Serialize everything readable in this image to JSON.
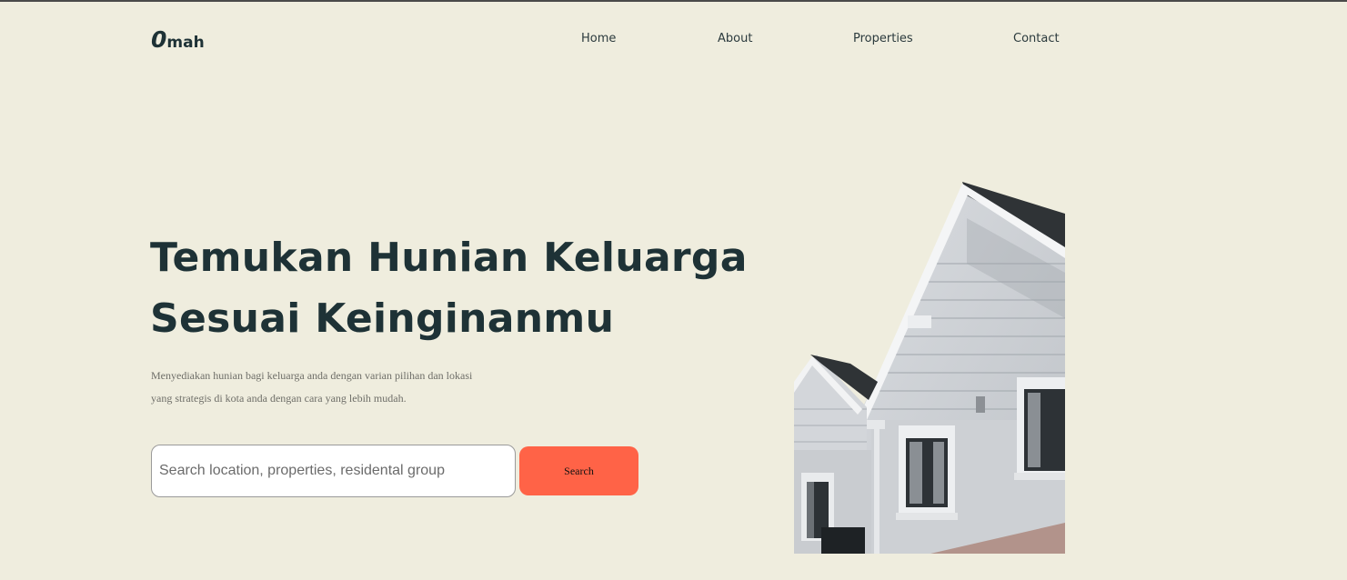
{
  "nav": {
    "logo_mark": "0",
    "logo_text": "mah",
    "links": [
      {
        "label": "Home"
      },
      {
        "label": "About"
      },
      {
        "label": "Properties"
      },
      {
        "label": "Contact"
      }
    ]
  },
  "hero": {
    "title_line1": "Temukan Hunian Keluarga",
    "title_line2": "Sesuai Keinginanmu",
    "description_line1": "Menyediakan hunian bagi keluarga anda dengan varian pilihan dan lokasi",
    "description_line2": "yang strategis di kota anda dengan cara yang lebih mudah.",
    "search": {
      "placeholder": "Search location, properties, residental group",
      "value": "",
      "button_label": "Search"
    }
  },
  "colors": {
    "background": "#EFEDDE",
    "text_dark": "#1E3236",
    "accent": "#FF6347",
    "input_bg": "#FFFFFF"
  },
  "image": {
    "subject": "white-house-photo"
  }
}
